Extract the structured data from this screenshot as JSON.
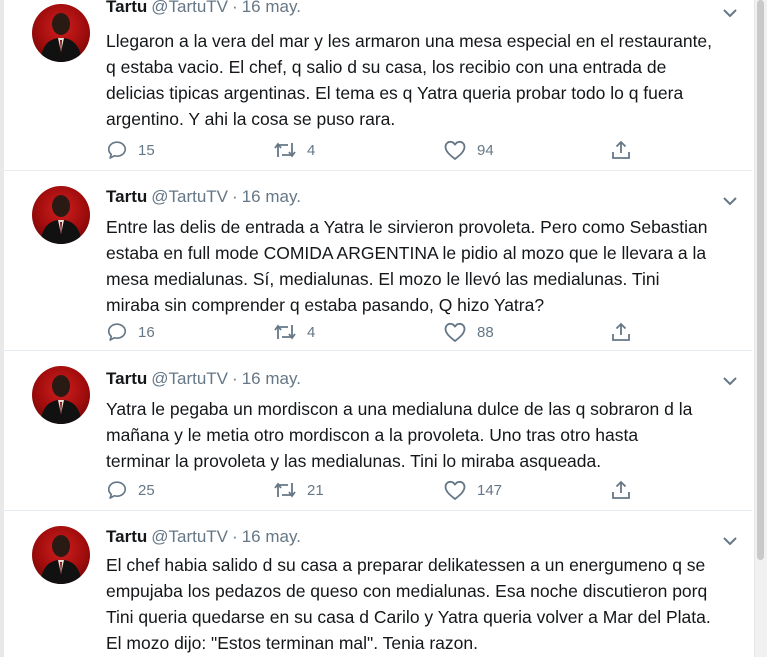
{
  "tweets": [
    {
      "name": "Tartu",
      "handle": "@TartuTV",
      "date": "16 may.",
      "text": "Llegaron a la vera del mar y les armaron una mesa especial en el restaurante,\nq estaba vacio. El chef, q salio d su casa, los recibio con una entrada de\ndelicias tipicas argentinas. El tema es q Yatra queria probar todo lo q fuera\nargentino. Y ahi la cosa se puso rara.",
      "replies": "15",
      "retweets": "4",
      "likes": "94"
    },
    {
      "name": "Tartu",
      "handle": "@TartuTV",
      "date": "16 may.",
      "text": "Entre las delis de entrada a Yatra le sirvieron provoleta. Pero como Sebastian\nestaba en full mode COMIDA ARGENTINA le pidio al mozo que le llevara a la\nmesa medialunas. Sí, medialunas. El mozo le llevó las medialunas. Tini\nmiraba sin comprender q estaba pasando, Q hizo Yatra?",
      "replies": "16",
      "retweets": "4",
      "likes": "88"
    },
    {
      "name": "Tartu",
      "handle": "@TartuTV",
      "date": "16 may.",
      "text": "Yatra le pegaba un mordiscon a una medialuna dulce de las q sobraron d la\nmañana y le metia otro mordiscon a la provoleta. Uno tras otro hasta\nterminar la provoleta y las medialunas. Tini lo miraba asqueada.",
      "replies": "25",
      "retweets": "21",
      "likes": "147"
    },
    {
      "name": "Tartu",
      "handle": "@TartuTV",
      "date": "16 may.",
      "text": "El chef habia salido d su casa a preparar delikatessen a un energumeno q se\nempujaba los pedazos de queso con medialunas. Esa noche discutieron porq\nTini queria quedarse en su casa d Carilo y Yatra queria volver a Mar del Plata.\nEl mozo dijo: \"Estos terminan mal\". Tenia razon."
    }
  ],
  "colors": {
    "text": "#14171a",
    "secondary": "#657786",
    "divider": "#e6ecf0",
    "avatar": "#c41616"
  },
  "icons": [
    "reply-icon",
    "retweet-icon",
    "like-icon",
    "share-icon",
    "chevron-down-icon"
  ]
}
